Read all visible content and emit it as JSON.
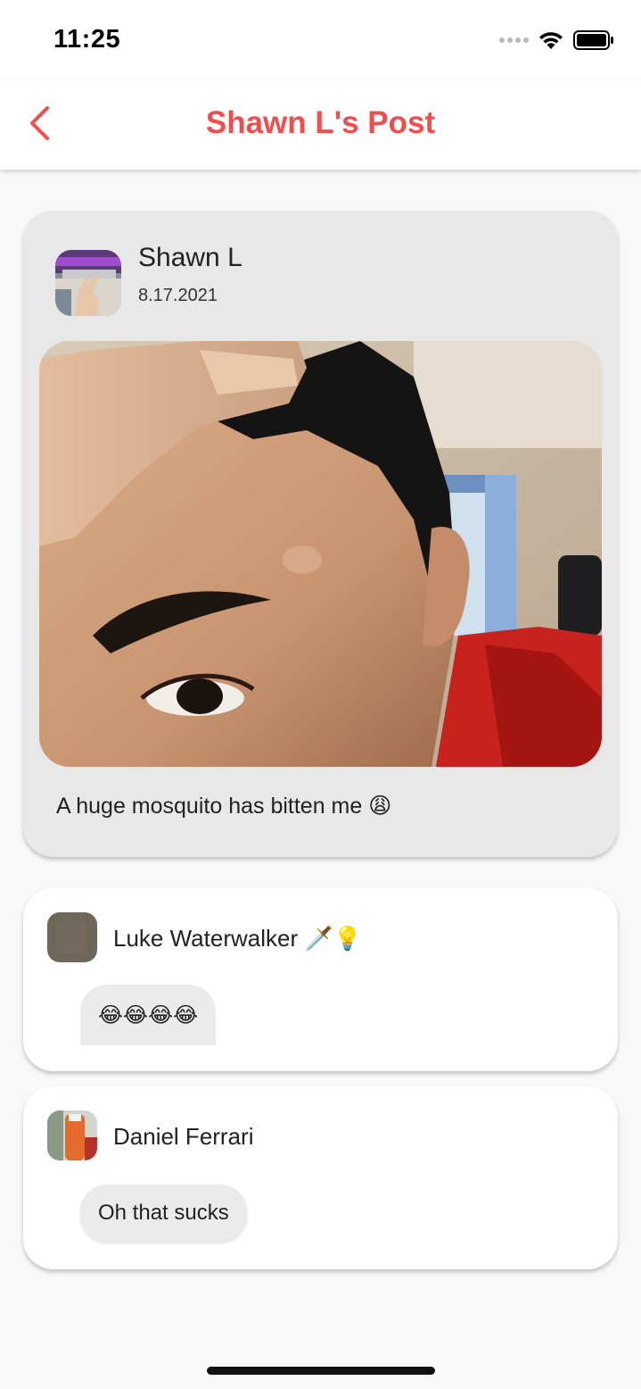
{
  "status_bar": {
    "time": "11:25"
  },
  "nav": {
    "title": "Shawn L's Post",
    "accent_color": "#f24c4c",
    "back_icon": "chevron-left-icon"
  },
  "post": {
    "author": "Shawn L",
    "date": "8.17.2021",
    "caption": "A huge mosquito has bitten me 😩",
    "image_desc": "photo"
  },
  "comments": [
    {
      "author": "Luke Waterwalker 🗡️💡",
      "text": "😂😂😂😂"
    },
    {
      "author": "Daniel Ferrari",
      "text": "Oh that sucks"
    }
  ]
}
